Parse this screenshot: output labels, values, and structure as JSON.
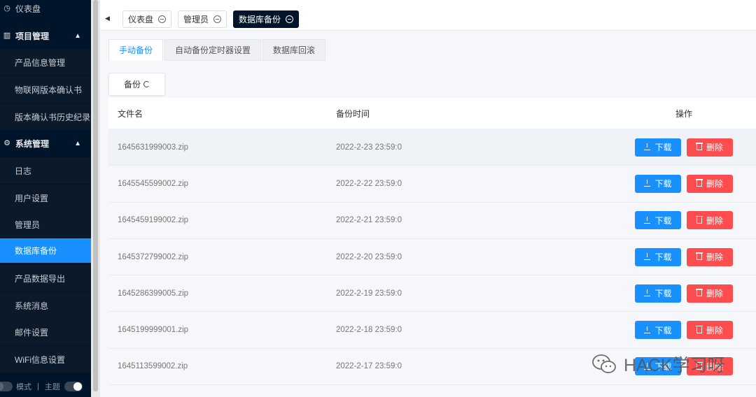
{
  "sidebar": {
    "items": [
      {
        "label": "仪表盘",
        "type": "top",
        "icon": "dashboard-icon"
      },
      {
        "label": "项目管理",
        "type": "group",
        "icon": "project-icon"
      },
      {
        "label": "产品信息管理",
        "type": "sub"
      },
      {
        "label": "物联网版本确认书",
        "type": "sub"
      },
      {
        "label": "版本确认书历史纪录",
        "type": "sub"
      },
      {
        "label": "系统管理",
        "type": "group",
        "icon": "gear-icon"
      },
      {
        "label": "日志",
        "type": "sub"
      },
      {
        "label": "用户设置",
        "type": "sub"
      },
      {
        "label": "管理员",
        "type": "sub"
      },
      {
        "label": "数据库备份",
        "type": "sub",
        "active": true
      },
      {
        "label": "产品数据导出",
        "type": "sub"
      },
      {
        "label": "系统消息",
        "type": "sub"
      },
      {
        "label": "邮件设置",
        "type": "sub"
      },
      {
        "label": "WiFi信息设置",
        "type": "sub"
      }
    ],
    "bottom": {
      "mode_label": "模式",
      "separator": "|",
      "theme_label": "主题"
    }
  },
  "tags": [
    {
      "label": "仪表盘",
      "active": false
    },
    {
      "label": "管理员",
      "active": false
    },
    {
      "label": "数据库备份",
      "active": true
    }
  ],
  "tabs": [
    {
      "label": "手动备份",
      "active": true
    },
    {
      "label": "自动备份定时器设置",
      "active": false
    },
    {
      "label": "数据库回滚",
      "active": false
    }
  ],
  "backup_button": {
    "label": "备份"
  },
  "table": {
    "headers": {
      "name": "文件名",
      "time": "备份时间",
      "ops": "操作"
    },
    "download_label": "下载",
    "delete_label": "删除",
    "rows": [
      {
        "name": "1645631999003.zip",
        "time": "2022-2-23 23:59:0"
      },
      {
        "name": "1645545599002.zip",
        "time": "2022-2-22 23:59:0"
      },
      {
        "name": "1645459199002.zip",
        "time": "2022-2-21 23:59:0"
      },
      {
        "name": "1645372799002.zip",
        "time": "2022-2-20 23:59:0"
      },
      {
        "name": "1645286399005.zip",
        "time": "2022-2-19 23:59:0"
      },
      {
        "name": "1645199999001.zip",
        "time": "2022-2-18 23:59:0"
      },
      {
        "name": "1645113599002.zip",
        "time": "2022-2-17 23:59:0"
      }
    ]
  },
  "watermark": {
    "text": "HACK学习呀"
  },
  "colors": {
    "sidebar_bg": "#001529",
    "active": "#1890ff",
    "danger": "#ff4d4f"
  }
}
